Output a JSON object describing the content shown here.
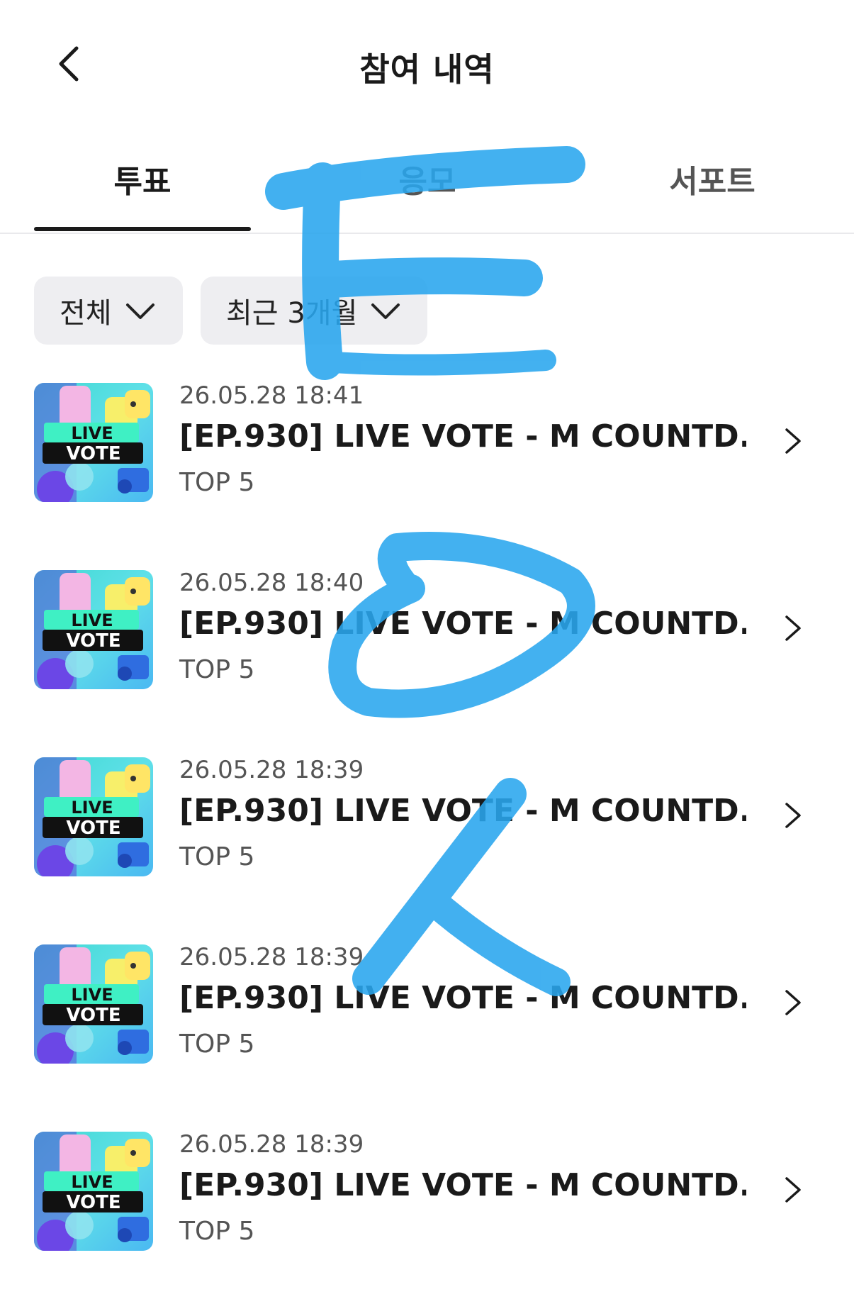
{
  "header": {
    "title": "참여 내역"
  },
  "tabs": [
    {
      "label": "투표",
      "active": true
    },
    {
      "label": "응모",
      "active": false
    },
    {
      "label": "서포트",
      "active": false
    }
  ],
  "filters": {
    "category": "전체",
    "period": "최근 3개월"
  },
  "thumbnail": {
    "line1": "LIVE",
    "line2": "VOTE"
  },
  "items": [
    {
      "date": "26.05.28 18:41",
      "title": "[EP.930] LIVE VOTE - M COUNTD...",
      "subtitle": "TOP 5"
    },
    {
      "date": "26.05.28 18:40",
      "title": "[EP.930] LIVE VOTE - M COUNTD...",
      "subtitle": "TOP 5"
    },
    {
      "date": "26.05.28 18:39",
      "title": "[EP.930] LIVE VOTE - M COUNTD...",
      "subtitle": "TOP 5"
    },
    {
      "date": "26.05.28 18:39",
      "title": "[EP.930] LIVE VOTE - M COUNTD...",
      "subtitle": "TOP 5"
    },
    {
      "date": "26.05.28 18:39",
      "title": "[EP.930] LIVE VOTE - M COUNTD...",
      "subtitle": "TOP 5"
    }
  ],
  "colors": {
    "scribble": "#29a6ee",
    "text_primary": "#1a1a1a",
    "text_secondary": "#555555",
    "chip_bg": "#eeeef1"
  }
}
